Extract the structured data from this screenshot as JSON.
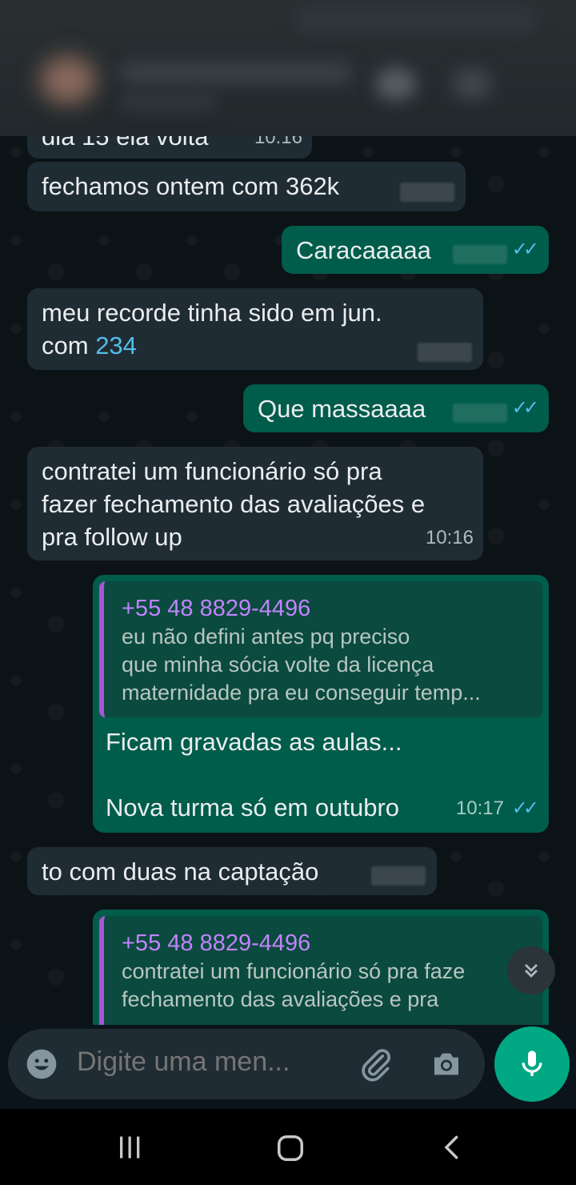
{
  "colors": {
    "accent": "#00a884",
    "incoming_bubble": "#202c33",
    "outgoing_bubble": "#005c4b",
    "read_ticks": "#53bdeb",
    "quote_name": "#c084fc"
  },
  "messages": [
    {
      "type": "in",
      "text": "dia 15 ela volta",
      "time": "10:16"
    },
    {
      "type": "in",
      "text": "fechamos ontem com 362k"
    },
    {
      "type": "out",
      "text": "Caracaaaaa"
    },
    {
      "type": "in",
      "line1": "meu recorde tinha sido em jun.",
      "line2_prefix": "com ",
      "line2_number": "234"
    },
    {
      "type": "out",
      "text": "Que massaaaa"
    },
    {
      "type": "in",
      "line1": "contratei um funcionário só pra",
      "line2": "fazer fechamento das avaliações e",
      "line3": "pra follow up",
      "time": "10:16"
    },
    {
      "type": "out",
      "quote_name": "+55 48 8829-4496",
      "quote_text": "eu não defini antes pq preciso\nque minha sócia volte da licença\nmaternidade pra eu conseguir temp...",
      "line1": "Ficam gravadas as aulas...",
      "line2": "Nova turma só em outubro",
      "time": "10:17"
    },
    {
      "type": "in",
      "text": "to com duas na captação"
    },
    {
      "type": "out",
      "quote_name": "+55 48 8829-4496",
      "quote_text": "contratei um funcionário só pra faze\nfechamento das avaliações e pra"
    }
  ],
  "input": {
    "placeholder": "Digite uma men..."
  },
  "icons": {
    "emoji": "emoji-icon",
    "attach": "paperclip-icon",
    "camera": "camera-icon",
    "mic": "microphone-icon",
    "scroll": "chevron-double-down-icon",
    "nav_recent": "recent-apps-icon",
    "nav_home": "home-icon",
    "nav_back": "back-icon"
  }
}
